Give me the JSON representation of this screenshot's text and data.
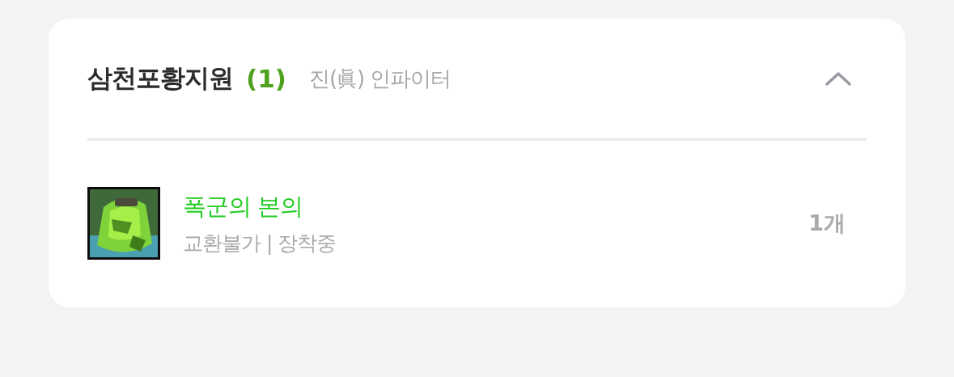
{
  "card": {
    "title": "삼천포황지원",
    "count": "(1)",
    "subtitle": "진(眞) 인파이터",
    "expanded": true,
    "items": [
      {
        "name": "폭군의 본의",
        "color": "#22cc22",
        "details": "교환불가 | 장착중",
        "quantity": "1개"
      }
    ]
  }
}
